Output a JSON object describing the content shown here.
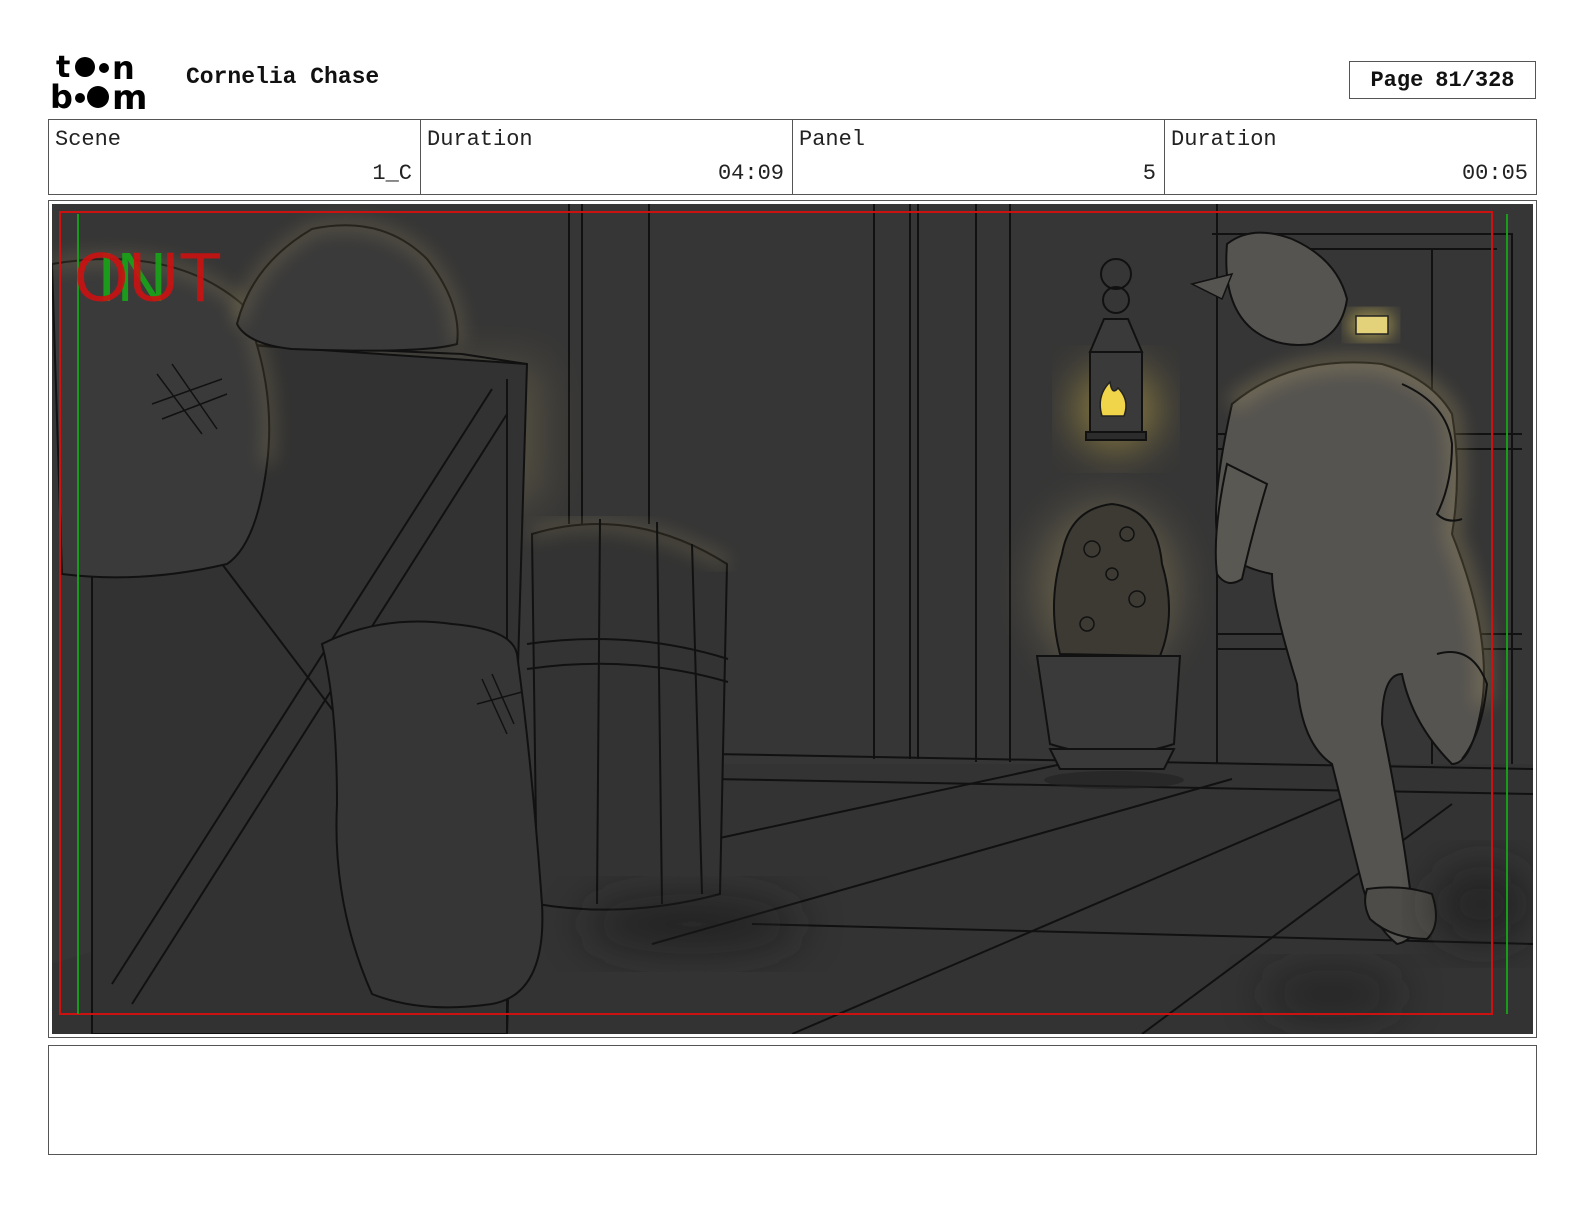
{
  "header": {
    "logo_text": "toon boom",
    "project_title": "Cornelia Chase",
    "page_label": "Page",
    "page_value": "81/328"
  },
  "info": {
    "scene_label": "Scene",
    "scene_value": "1_C",
    "scene_duration_label": "Duration",
    "scene_duration_value": "04:09",
    "panel_label": "Panel",
    "panel_value": "5",
    "panel_duration_label": "Duration",
    "panel_duration_value": "00:05"
  },
  "panel": {
    "out_marker": "OUT",
    "in_marker": "IN",
    "description": "Storyboard sketch: interior with crates, sacks and a barrel on the left, a hanging lit lantern and potted bush in the middle, a pointed-eared character running toward a door on the right."
  },
  "notes": {
    "text": ""
  },
  "colors": {
    "panel_bg": "#333333",
    "glow": "#b8a468",
    "safe_frame_red": "#cc1111",
    "safe_frame_green": "#1a9a1a"
  }
}
